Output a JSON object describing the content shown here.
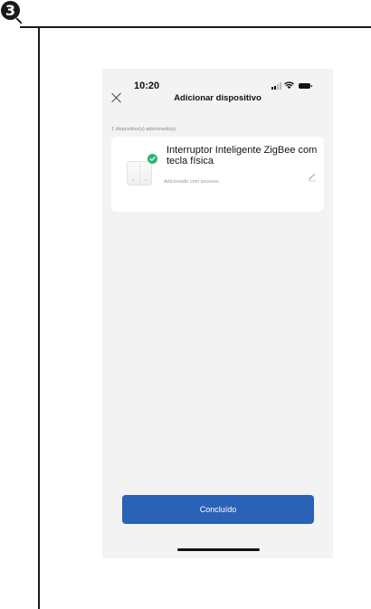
{
  "step": {
    "number": "3"
  },
  "status_bar": {
    "time": "10:20"
  },
  "header": {
    "title": "Adicionar dispositivo"
  },
  "summary": {
    "added_count_label": "1 dispositivo(s) adicionado(s)"
  },
  "device": {
    "name": "Interruptor Inteligente ZigBee com tecla física",
    "status": "Adicionado com sucesso",
    "status_color": "#2bb673"
  },
  "footer": {
    "done_label": "Concluído",
    "accent_color": "#2a62b8"
  }
}
